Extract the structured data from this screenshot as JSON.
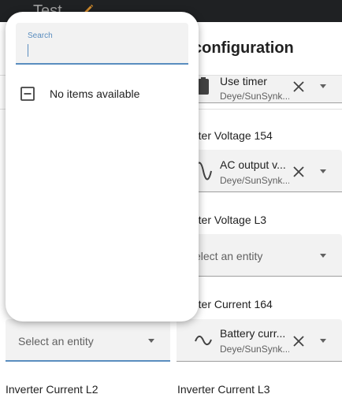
{
  "app_bar": {
    "title": "Test"
  },
  "page": {
    "title": "configuration"
  },
  "sections": {
    "timer": {
      "entity_name": "Use timer",
      "entity_source": "Deye/SunSynk..."
    },
    "voltage_154": {
      "label": "rter Voltage 154",
      "entity_name": "AC output v...",
      "entity_source": "Deye/SunSynk..."
    },
    "voltage_l3": {
      "label": "rter Voltage L3",
      "placeholder": "elect an entity"
    },
    "current_164": {
      "label": "rter Current 164",
      "entity_name": "Battery curr...",
      "entity_source": "Deye/SunSynk..."
    },
    "left_field": {
      "placeholder": "Select an entity"
    },
    "current_l2": {
      "label": "Inverter Current L2"
    },
    "current_l3": {
      "label": "Inverter Current L3"
    }
  },
  "dialog": {
    "search_label": "Search",
    "search_value": "",
    "empty_text": "No items available"
  },
  "colors": {
    "app_bar": "#1f2123",
    "accent": "#5a8dbf",
    "field_bg": "#f2f2f2",
    "icon": "#424242"
  },
  "icons": {
    "app_bar_edit": "pencil-icon",
    "timer": "timer-icon",
    "voltage": "sine-wave-icon",
    "current": "ac-wave-icon",
    "clear": "close-icon",
    "dropdown": "arrow-down-icon",
    "empty": "minus-box-icon"
  }
}
